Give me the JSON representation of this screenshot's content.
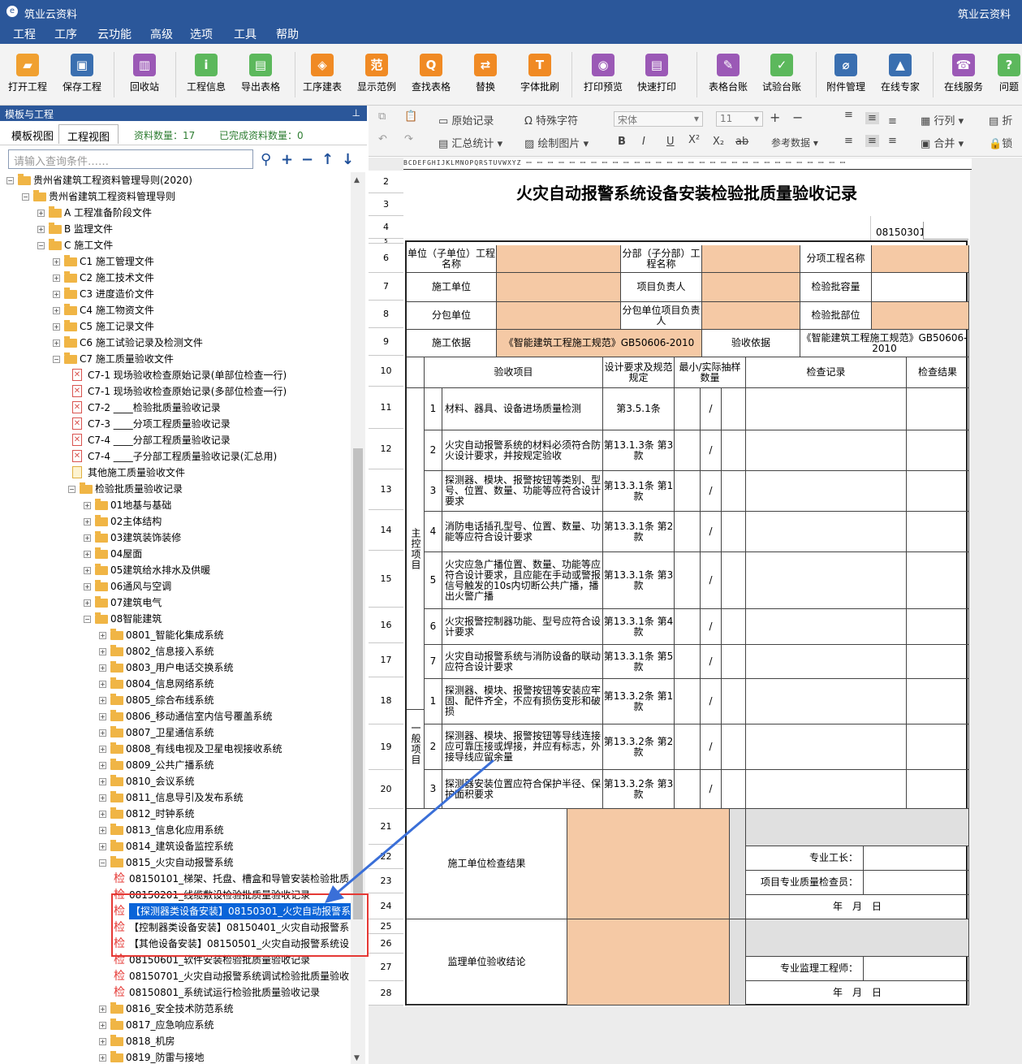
{
  "app": {
    "title": "筑业云资料",
    "title_right": "筑业云资料"
  },
  "menu": [
    "工程",
    "工序",
    "云功能",
    "高级",
    "选项",
    "工具",
    "帮助"
  ],
  "toolbar": [
    {
      "label": "打开工程",
      "icon": "folder-icon",
      "color": "#f0a030"
    },
    {
      "label": "保存工程",
      "icon": "save-icon",
      "color": "#3a6fb0"
    },
    {
      "label": "回收站",
      "icon": "trash-icon",
      "color": "#9b59b6"
    },
    {
      "label": "工程信息",
      "icon": "info-icon",
      "color": "#5cb85c"
    },
    {
      "label": "导出表格",
      "icon": "export-icon",
      "color": "#5cb85c"
    },
    {
      "label": "工序建表",
      "icon": "layers-icon",
      "color": "#f08a24"
    },
    {
      "label": "显示范例",
      "icon": "example-icon",
      "color": "#f08a24"
    },
    {
      "label": "查找表格",
      "icon": "search-icon",
      "color": "#f08a24"
    },
    {
      "label": "替换",
      "icon": "replace-icon",
      "color": "#f08a24"
    },
    {
      "label": "字体批刷",
      "icon": "font-icon",
      "color": "#f08a24"
    },
    {
      "label": "打印预览",
      "icon": "eye-icon",
      "color": "#9b59b6"
    },
    {
      "label": "快速打印",
      "icon": "printer-icon",
      "color": "#9b59b6"
    },
    {
      "label": "表格台账",
      "icon": "ledger-icon",
      "color": "#9b59b6"
    },
    {
      "label": "试验台账",
      "icon": "test-ledger-icon",
      "color": "#5cb85c"
    },
    {
      "label": "附件管理",
      "icon": "attachment-icon",
      "color": "#3a6fb0"
    },
    {
      "label": "在线专家",
      "icon": "expert-icon",
      "color": "#3a6fb0"
    },
    {
      "label": "在线服务",
      "icon": "service-icon",
      "color": "#9b59b6"
    },
    {
      "label": "问题",
      "icon": "question-icon",
      "color": "#5cb85c"
    }
  ],
  "left": {
    "panel_title": "模板与工程",
    "tabs": [
      "模板视图",
      "工程视图"
    ],
    "count_label": "资料数量：17",
    "done_label": "已完成资料数量：0",
    "search_placeholder": "请输入查询条件……"
  },
  "tree": [
    {
      "text": "贵州省建筑工程资料管理导则(2020)",
      "lv": 0,
      "t": "fo",
      "ex": "-"
    },
    {
      "text": "贵州省建筑工程资料管理导则",
      "lv": 1,
      "t": "fo",
      "ex": "-"
    },
    {
      "text": "A 工程准备阶段文件",
      "lv": 2,
      "t": "f",
      "ex": "+"
    },
    {
      "text": "B 监理文件",
      "lv": 2,
      "t": "f",
      "ex": "+"
    },
    {
      "text": "C 施工文件",
      "lv": 2,
      "t": "fo",
      "ex": "-"
    },
    {
      "text": "C1 施工管理文件",
      "lv": 3,
      "t": "f",
      "ex": "+"
    },
    {
      "text": "C2 施工技术文件",
      "lv": 3,
      "t": "f",
      "ex": "+"
    },
    {
      "text": "C3 进度造价文件",
      "lv": 3,
      "t": "f",
      "ex": "+"
    },
    {
      "text": "C4 施工物资文件",
      "lv": 3,
      "t": "f",
      "ex": "+"
    },
    {
      "text": "C5 施工记录文件",
      "lv": 3,
      "t": "f",
      "ex": "+"
    },
    {
      "text": "C6 施工试验记录及检测文件",
      "lv": 3,
      "t": "f",
      "ex": "+"
    },
    {
      "text": "C7 施工质量验收文件",
      "lv": 3,
      "t": "fo",
      "ex": "-"
    },
    {
      "text": "C7-1 现场验收检查原始记录(单部位检查一行)",
      "lv": 4,
      "t": "p",
      "ex": ""
    },
    {
      "text": "C7-1 现场验收检查原始记录(多部位检查一行)",
      "lv": 4,
      "t": "p",
      "ex": ""
    },
    {
      "text": "C7-2 ____检验批质量验收记录",
      "lv": 4,
      "t": "p",
      "ex": ""
    },
    {
      "text": "C7-3 ____分项工程质量验收记录",
      "lv": 4,
      "t": "p",
      "ex": ""
    },
    {
      "text": "C7-4 ____分部工程质量验收记录",
      "lv": 4,
      "t": "p",
      "ex": ""
    },
    {
      "text": "C7-4 ____子分部工程质量验收记录(汇总用)",
      "lv": 4,
      "t": "p",
      "ex": ""
    },
    {
      "text": "其他施工质量验收文件",
      "lv": 4,
      "t": "d",
      "ex": ""
    },
    {
      "text": "检验批质量验收记录",
      "lv": 4,
      "t": "fo",
      "ex": "-"
    },
    {
      "text": "01地基与基础",
      "lv": 5,
      "t": "f",
      "ex": "+"
    },
    {
      "text": "02主体结构",
      "lv": 5,
      "t": "f",
      "ex": "+"
    },
    {
      "text": "03建筑装饰装修",
      "lv": 5,
      "t": "f",
      "ex": "+"
    },
    {
      "text": "04屋面",
      "lv": 5,
      "t": "f",
      "ex": "+"
    },
    {
      "text": "05建筑给水排水及供暖",
      "lv": 5,
      "t": "f",
      "ex": "+"
    },
    {
      "text": "06通风与空调",
      "lv": 5,
      "t": "f",
      "ex": "+"
    },
    {
      "text": "07建筑电气",
      "lv": 5,
      "t": "f",
      "ex": "+"
    },
    {
      "text": "08智能建筑",
      "lv": 5,
      "t": "fo",
      "ex": "-"
    },
    {
      "text": "0801_智能化集成系统",
      "lv": 6,
      "t": "f",
      "ex": "+"
    },
    {
      "text": "0802_信息接入系统",
      "lv": 6,
      "t": "f",
      "ex": "+"
    },
    {
      "text": "0803_用户电话交换系统",
      "lv": 6,
      "t": "f",
      "ex": "+"
    },
    {
      "text": "0804_信息网络系统",
      "lv": 6,
      "t": "f",
      "ex": "+"
    },
    {
      "text": "0805_综合布线系统",
      "lv": 6,
      "t": "f",
      "ex": "+"
    },
    {
      "text": "0806_移动通信室内信号覆盖系统",
      "lv": 6,
      "t": "f",
      "ex": "+"
    },
    {
      "text": "0807_卫星通信系统",
      "lv": 6,
      "t": "f",
      "ex": "+"
    },
    {
      "text": "0808_有线电视及卫星电视接收系统",
      "lv": 6,
      "t": "f",
      "ex": "+"
    },
    {
      "text": "0809_公共广播系统",
      "lv": 6,
      "t": "f",
      "ex": "+"
    },
    {
      "text": "0810_会议系统",
      "lv": 6,
      "t": "f",
      "ex": "+"
    },
    {
      "text": "0811_信息导引及发布系统",
      "lv": 6,
      "t": "f",
      "ex": "+"
    },
    {
      "text": "0812_时钟系统",
      "lv": 6,
      "t": "f",
      "ex": "+"
    },
    {
      "text": "0813_信息化应用系统",
      "lv": 6,
      "t": "f",
      "ex": "+"
    },
    {
      "text": "0814_建筑设备监控系统",
      "lv": 6,
      "t": "f",
      "ex": "+"
    },
    {
      "text": "0815_火灾自动报警系统",
      "lv": 6,
      "t": "fo",
      "ex": "-"
    },
    {
      "text": "08150101_梯架、托盘、槽盒和导管安装检验批质",
      "lv": 7,
      "t": "j",
      "ex": ""
    },
    {
      "text": "08150201_线缆敷设检验批质量验收记录",
      "lv": 7,
      "t": "j",
      "ex": ""
    },
    {
      "text": "【探测器类设备安装】08150301_火灾自动报警系",
      "lv": 7,
      "t": "j",
      "ex": "",
      "sel": true
    },
    {
      "text": "【控制器类设备安装】08150401_火灾自动报警系",
      "lv": 7,
      "t": "j",
      "ex": ""
    },
    {
      "text": "【其他设备安装】08150501_火灾自动报警系统设",
      "lv": 7,
      "t": "j",
      "ex": ""
    },
    {
      "text": "08150601_软件安装检验批质量验收记录",
      "lv": 7,
      "t": "j",
      "ex": ""
    },
    {
      "text": "08150701_火灾自动报警系统调试检验批质量验收",
      "lv": 7,
      "t": "j",
      "ex": ""
    },
    {
      "text": "08150801_系统试运行检验批质量验收记录",
      "lv": 7,
      "t": "j",
      "ex": ""
    },
    {
      "text": "0816_安全技术防范系统",
      "lv": 6,
      "t": "f",
      "ex": "+"
    },
    {
      "text": "0817_应急响应系统",
      "lv": 6,
      "t": "f",
      "ex": "+"
    },
    {
      "text": "0818_机房",
      "lv": 6,
      "t": "f",
      "ex": "+"
    },
    {
      "text": "0819_防雷与接地",
      "lv": 6,
      "t": "f",
      "ex": "+"
    }
  ],
  "jian_glyph": "检",
  "toolbar2": {
    "original_record": "原始记录",
    "summary": "汇总统计",
    "special_char": "特殊字符",
    "insert_image": "绘制图片",
    "font": "宋体",
    "size": "11",
    "ref_data": "参考数据",
    "row_col": "行列",
    "merge": "合并",
    "fold": "折",
    "lock": "锁",
    "bold": "B",
    "italic": "I",
    "underline": "U",
    "sup": "X²",
    "sub": "X₂",
    "strike": "ab"
  },
  "col_header": "BCDEFGHIJKLMNOPQRSTUVWXYZ ꟷ ꟷ ꟷ ꟷ ꟷ ꟷ ꟷ ꟷ ꟷ ꟷ ꟷ ꟷ ꟷ ꟷ ꟷ ꟷ ꟷ ꟷ ꟷ ꟷ ꟷ ꟷ ꟷ ꟷ ꟷ ꟷ ꟷ ꟷ ꟷ ꟷ",
  "row_numbers": [
    "2",
    "3",
    "4",
    "5",
    "6",
    "7",
    "8",
    "9",
    "10",
    "11",
    "12",
    "13",
    "14",
    "15",
    "16",
    "17",
    "18",
    "19",
    "20",
    "21",
    "22",
    "23",
    "24",
    "25",
    "26",
    "27",
    "28"
  ],
  "sheet": {
    "title": "火灾自动报警系统设备安装检验批质量验收记录",
    "code": "08150301",
    "h": {
      "unit_name": "单位（子单位）工程名称",
      "subdiv_name": "分部（子分部）工程名称",
      "item_name": "分项工程名称",
      "contractor": "施工单位",
      "pm": "项目负责人",
      "capacity": "检验批容量",
      "subcontractor": "分包单位",
      "sub_pm": "分包单位项目负责人",
      "location": "检验批部位",
      "basis_label": "施工依据",
      "basis_value": "《智能建筑工程施工规范》GB50606-2010",
      "acc_basis_label": "验收依据",
      "acc_basis_value": "《智能建筑工程施工规范》GB50606-2010"
    },
    "col": {
      "item": "验收项目",
      "req": "设计要求及规范规定",
      "min": "最小/实际抽样数量",
      "record": "检查记录",
      "result": "检查结果"
    },
    "main_label": "主控项目",
    "general_label": "一般项目",
    "main_items": [
      {
        "n": "1",
        "text": "材料、器具、设备进场质量检测",
        "clause": "第3.5.1条"
      },
      {
        "n": "2",
        "text": "火灾自动报警系统的材料必须符合防火设计要求，并按规定验收",
        "clause": "第13.1.3条 第3款"
      },
      {
        "n": "3",
        "text": "探测器、模块、报警按钮等类别、型号、位置、数量、功能等应符合设计要求",
        "clause": "第13.3.1条 第1款"
      },
      {
        "n": "4",
        "text": "消防电话插孔型号、位置、数量、功能等应符合设计要求",
        "clause": "第13.3.1条 第2款"
      },
      {
        "n": "5",
        "text": "火灾应急广播位置、数量、功能等应符合设计要求，且应能在手动或警报信号触发的10s内切断公共广播，播出火警广播",
        "clause": "第13.3.1条 第3款"
      },
      {
        "n": "6",
        "text": "火灾报警控制器功能、型号应符合设计要求",
        "clause": "第13.3.1条 第4款"
      },
      {
        "n": "7",
        "text": "火灾自动报警系统与消防设备的联动应符合设计要求",
        "clause": "第13.3.1条 第5款"
      }
    ],
    "general_items": [
      {
        "n": "1",
        "text": "探测器、模块、报警按钮等安装应牢固、配件齐全，不应有损伤变形和破损",
        "clause": "第13.3.2条 第1款"
      },
      {
        "n": "2",
        "text": "探测器、模块、报警按钮等导线连接应可靠压接或焊接，并应有标志，外接导线应留余量",
        "clause": "第13.3.2条 第2款"
      },
      {
        "n": "3",
        "text": "探测器安装位置应符合保护半径、保护面积要求",
        "clause": "第13.3.2条 第3款"
      }
    ],
    "slash": "/",
    "contractor_check": "施工单位检查结果",
    "foreman": "专业工长：",
    "qc_inspector": "项目专业质量检查员：",
    "date": "年　月　日",
    "supervisor_conclusion": "监理单位验收结论",
    "supervisor_engineer": "专业监理工程师："
  }
}
